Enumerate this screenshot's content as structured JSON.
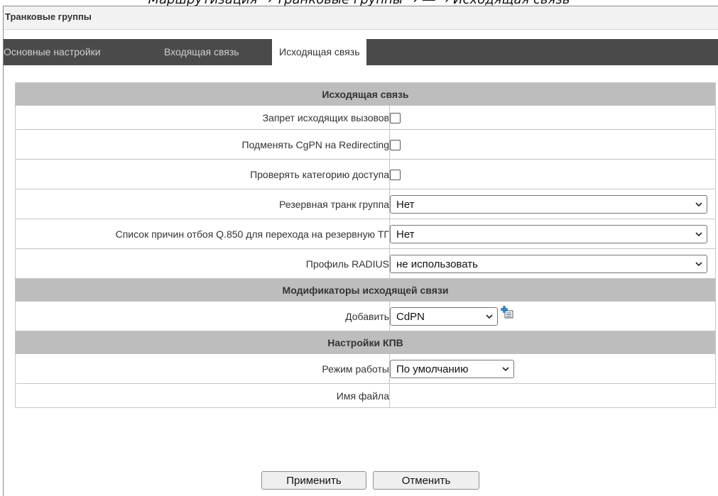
{
  "caption": "Маршрутизация → Транковые группы → ⎯⎯ → Исходящая связь",
  "window_title": "Транковые группы",
  "tabs": [
    {
      "label": "Основные настройки",
      "active": false
    },
    {
      "label": "Входящая связь",
      "active": false
    },
    {
      "label": "Исходящая связь",
      "active": true
    }
  ],
  "sections": {
    "outgoing": {
      "header": "Исходящая связь",
      "deny_outgoing_label": "Запрет исходящих вызовов",
      "deny_outgoing_checked": false,
      "replace_cgpn_label": "Подменять CgPN на Redirecting",
      "replace_cgpn_checked": false,
      "check_access_label": "Проверять категорию доступа",
      "check_access_checked": false,
      "backup_trunk_label": "Резервная транк группа",
      "backup_trunk_value": "Нет",
      "q850_label": "Список причин отбоя Q.850 для перехода на резервную ТГ",
      "q850_value": "Нет",
      "radius_label": "Профиль RADIUS",
      "radius_value": "не использовать"
    },
    "modifiers": {
      "header": "Модификаторы исходящей связи",
      "add_label": "Добавить",
      "add_value": "CdPN"
    },
    "kpv": {
      "header": "Настройки КПВ",
      "mode_label": "Режим работы",
      "mode_value": "По умолчанию",
      "filename_label": "Имя файла",
      "filename_value": ""
    }
  },
  "buttons": {
    "apply": "Применить",
    "cancel": "Отменить"
  },
  "colors": {
    "tabbar_bg": "#4a4a4a",
    "section_header_bg": "#bdbdbd",
    "add_icon_accent": "#2b8fd6"
  },
  "icons": {
    "add": "add-row-icon",
    "dropdown": "chevron-down-icon"
  }
}
